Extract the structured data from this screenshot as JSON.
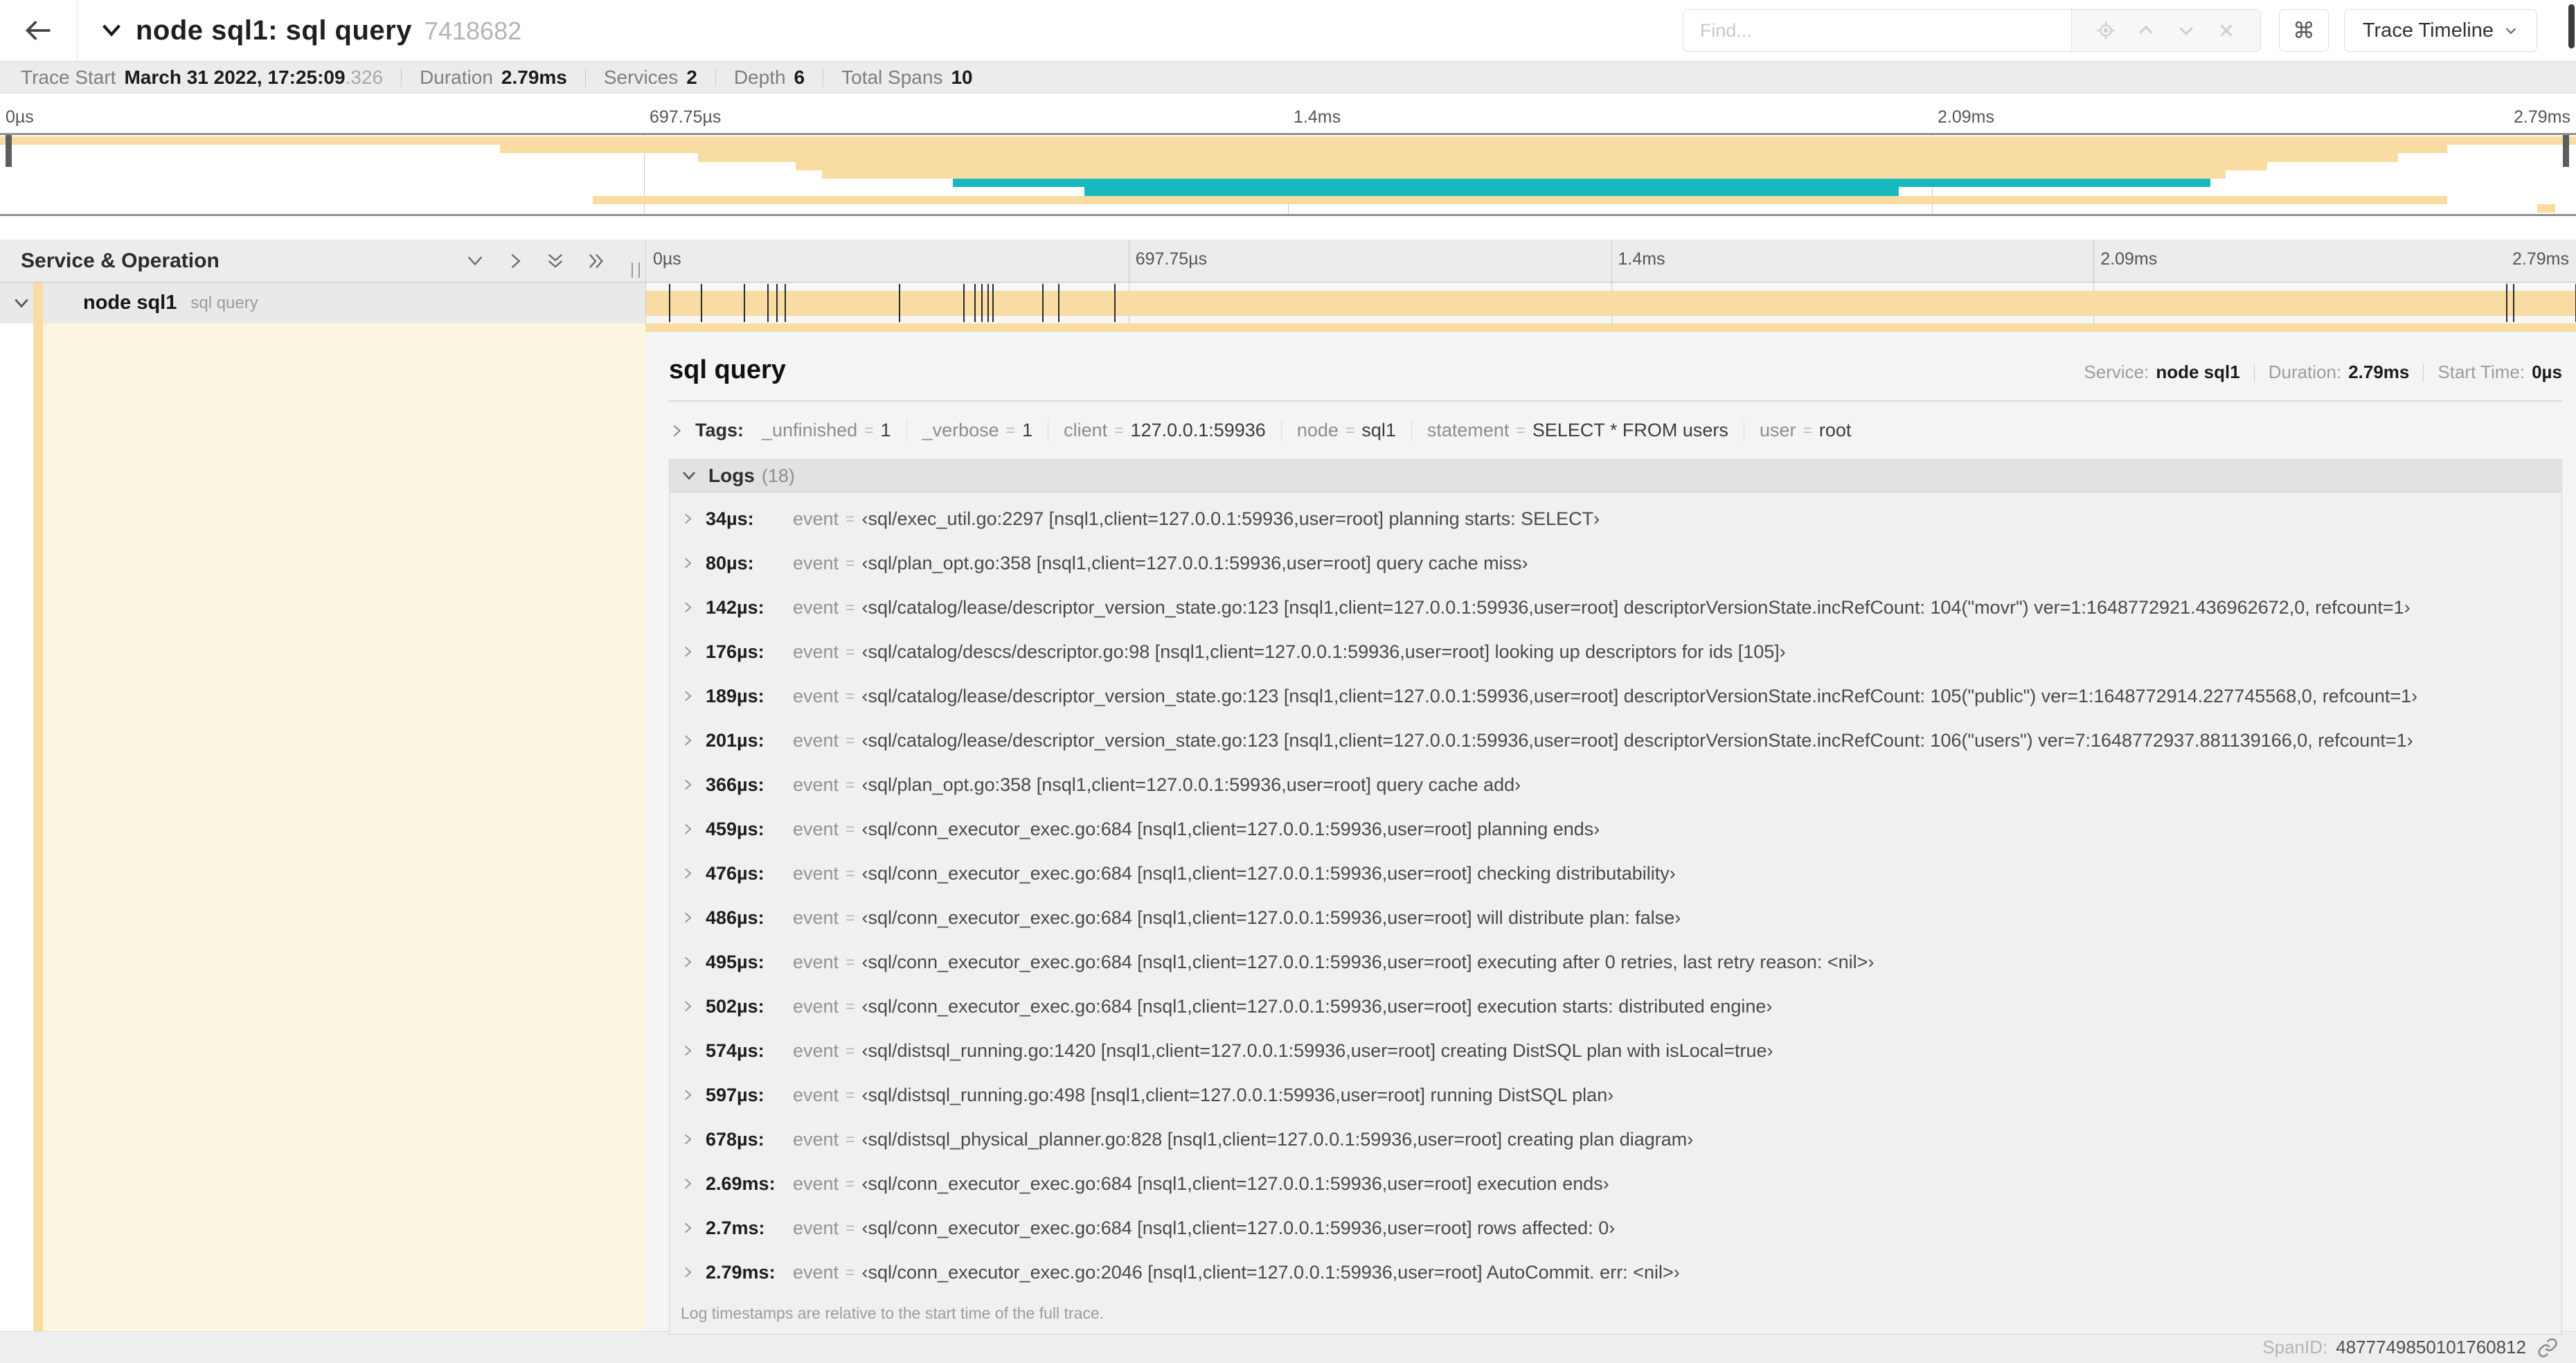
{
  "header": {
    "title": "node sql1: sql query",
    "trace_id": "7418682",
    "find_placeholder": "Find...",
    "shortcut_key": "⌘",
    "view_selector": "Trace Timeline"
  },
  "trace_stats": {
    "trace_start_label": "Trace Start",
    "trace_start_value": "March 31 2022, 17:25:09",
    "trace_start_fraction": ".326",
    "duration_label": "Duration",
    "duration_value": "2.79ms",
    "services_label": "Services",
    "services_value": "2",
    "depth_label": "Depth",
    "depth_value": "6",
    "total_spans_label": "Total Spans",
    "total_spans_value": "10"
  },
  "timeline": {
    "ticks": [
      "0µs",
      "697.75µs",
      "1.4ms",
      "2.09ms",
      "2.79ms"
    ],
    "colors": {
      "tan": "#F8DCA1",
      "teal": "#17B8BE"
    },
    "minimap_spans": [
      {
        "start_pct": 0,
        "end_pct": 100,
        "color": "#F8DCA1"
      },
      {
        "start_pct": 19.4,
        "end_pct": 95.0,
        "color": "#F8DCA1"
      },
      {
        "start_pct": 27.1,
        "end_pct": 93.1,
        "color": "#F8DCA1"
      },
      {
        "start_pct": 30.9,
        "end_pct": 88.0,
        "color": "#F8DCA1"
      },
      {
        "start_pct": 31.9,
        "end_pct": 86.4,
        "color": "#F8DCA1"
      },
      {
        "start_pct": 37.0,
        "end_pct": 85.8,
        "color": "#17B8BE"
      },
      {
        "start_pct": 42.1,
        "end_pct": 73.7,
        "color": "#17B8BE"
      },
      {
        "start_pct": 23.0,
        "end_pct": 95.0,
        "color": "#F8DCA1"
      },
      {
        "start_pct": 98.5,
        "end_pct": 99.2,
        "color": "#F8DCA1"
      }
    ]
  },
  "span_table": {
    "header": "Service & Operation",
    "row": {
      "service": "node sql1",
      "operation": "sql query"
    },
    "total_us": 2790,
    "tick_positions_us": [
      34,
      80,
      142,
      176,
      189,
      201,
      366,
      459,
      476,
      486,
      495,
      502,
      574,
      597,
      678,
      2690,
      2700,
      2790
    ]
  },
  "detail": {
    "title": "sql query",
    "service_label": "Service:",
    "service_value": "node sql1",
    "duration_label": "Duration:",
    "duration_value": "2.79ms",
    "start_label": "Start Time:",
    "start_value": "0µs",
    "tags_label": "Tags:",
    "tags": [
      {
        "key": "_unfinished",
        "value": "1"
      },
      {
        "key": "_verbose",
        "value": "1"
      },
      {
        "key": "client",
        "value": "127.0.0.1:59936"
      },
      {
        "key": "node",
        "value": "sql1"
      },
      {
        "key": "statement",
        "value": "SELECT * FROM users"
      },
      {
        "key": "user",
        "value": "root"
      }
    ],
    "logs": {
      "label": "Logs",
      "count": "(18)",
      "entries": [
        {
          "time": "34µs:",
          "field": "event",
          "value": "‹sql/exec_util.go:2297 [nsql1,client=127.0.0.1:59936,user=root] planning starts: SELECT›"
        },
        {
          "time": "80µs:",
          "field": "event",
          "value": "‹sql/plan_opt.go:358 [nsql1,client=127.0.0.1:59936,user=root] query cache miss›"
        },
        {
          "time": "142µs:",
          "field": "event",
          "value": "‹sql/catalog/lease/descriptor_version_state.go:123 [nsql1,client=127.0.0.1:59936,user=root] descriptorVersionState.incRefCount: 104(\"movr\") ver=1:1648772921.436962672,0, refcount=1›"
        },
        {
          "time": "176µs:",
          "field": "event",
          "value": "‹sql/catalog/descs/descriptor.go:98 [nsql1,client=127.0.0.1:59936,user=root] looking up descriptors for ids [105]›"
        },
        {
          "time": "189µs:",
          "field": "event",
          "value": "‹sql/catalog/lease/descriptor_version_state.go:123 [nsql1,client=127.0.0.1:59936,user=root] descriptorVersionState.incRefCount: 105(\"public\") ver=1:1648772914.227745568,0, refcount=1›"
        },
        {
          "time": "201µs:",
          "field": "event",
          "value": "‹sql/catalog/lease/descriptor_version_state.go:123 [nsql1,client=127.0.0.1:59936,user=root] descriptorVersionState.incRefCount: 106(\"users\") ver=7:1648772937.881139166,0, refcount=1›"
        },
        {
          "time": "366µs:",
          "field": "event",
          "value": "‹sql/plan_opt.go:358 [nsql1,client=127.0.0.1:59936,user=root] query cache add›"
        },
        {
          "time": "459µs:",
          "field": "event",
          "value": "‹sql/conn_executor_exec.go:684 [nsql1,client=127.0.0.1:59936,user=root] planning ends›"
        },
        {
          "time": "476µs:",
          "field": "event",
          "value": "‹sql/conn_executor_exec.go:684 [nsql1,client=127.0.0.1:59936,user=root] checking distributability›"
        },
        {
          "time": "486µs:",
          "field": "event",
          "value": "‹sql/conn_executor_exec.go:684 [nsql1,client=127.0.0.1:59936,user=root] will distribute plan: false›"
        },
        {
          "time": "495µs:",
          "field": "event",
          "value": "‹sql/conn_executor_exec.go:684 [nsql1,client=127.0.0.1:59936,user=root] executing after 0 retries, last retry reason: <nil>›"
        },
        {
          "time": "502µs:",
          "field": "event",
          "value": "‹sql/conn_executor_exec.go:684 [nsql1,client=127.0.0.1:59936,user=root] execution starts: distributed engine›"
        },
        {
          "time": "574µs:",
          "field": "event",
          "value": "‹sql/distsql_running.go:1420 [nsql1,client=127.0.0.1:59936,user=root] creating DistSQL plan with isLocal=true›"
        },
        {
          "time": "597µs:",
          "field": "event",
          "value": "‹sql/distsql_running.go:498 [nsql1,client=127.0.0.1:59936,user=root] running DistSQL plan›"
        },
        {
          "time": "678µs:",
          "field": "event",
          "value": "‹sql/distsql_physical_planner.go:828 [nsql1,client=127.0.0.1:59936,user=root] creating plan diagram›"
        },
        {
          "time": "2.69ms:",
          "field": "event",
          "value": "‹sql/conn_executor_exec.go:684 [nsql1,client=127.0.0.1:59936,user=root] execution ends›"
        },
        {
          "time": "2.7ms:",
          "field": "event",
          "value": "‹sql/conn_executor_exec.go:684 [nsql1,client=127.0.0.1:59936,user=root] rows affected: 0›"
        },
        {
          "time": "2.79ms:",
          "field": "event",
          "value": "‹sql/conn_executor_exec.go:2046 [nsql1,client=127.0.0.1:59936,user=root] AutoCommit. err: <nil>›"
        }
      ],
      "note": "Log timestamps are relative to the start time of the full trace."
    },
    "span_id_label": "SpanID:",
    "span_id_value": "4877749850101760812"
  }
}
